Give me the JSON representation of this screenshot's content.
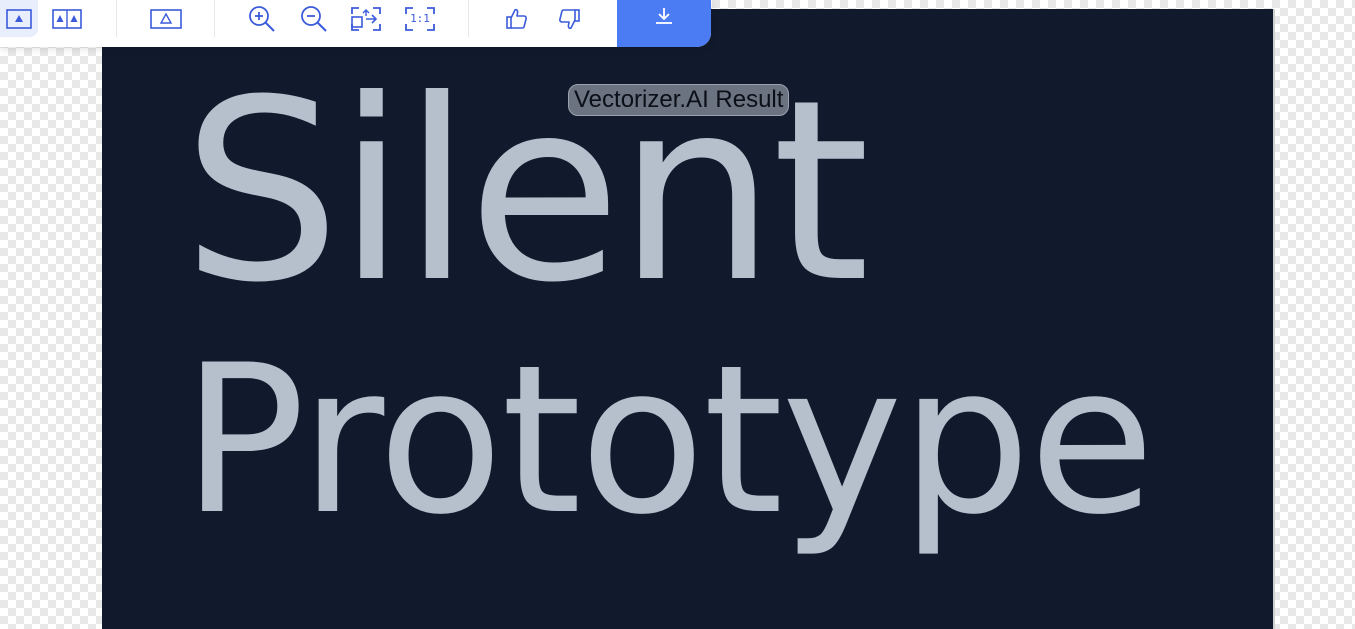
{
  "canvas": {
    "result_label": "Vectorizer.AI Result",
    "art_line_1": "Silent",
    "art_line_2": "Prototype",
    "background_color": "#111a2c",
    "text_color": "#b6bfcc"
  },
  "toolbar": {
    "buttons": [
      {
        "name": "view-single-button",
        "icon": "single-view-icon",
        "active": true
      },
      {
        "name": "view-side-by-side-button",
        "icon": "side-by-side-icon",
        "active": false
      },
      {
        "name": "view-result-button",
        "icon": "triangle-outline-icon",
        "active": false
      },
      {
        "name": "zoom-in-button",
        "icon": "zoom-in-icon",
        "active": false
      },
      {
        "name": "zoom-out-button",
        "icon": "zoom-out-icon",
        "active": false
      },
      {
        "name": "fit-button",
        "icon": "fit-screen-icon",
        "active": false
      },
      {
        "name": "actual-size-button",
        "icon": "one-to-one-icon",
        "label": "1:1",
        "active": false
      },
      {
        "name": "thumbs-up-button",
        "icon": "thumbs-up-icon",
        "active": false
      },
      {
        "name": "thumbs-down-button",
        "icon": "thumbs-down-icon",
        "active": false
      }
    ],
    "download": {
      "icon": "download-icon"
    },
    "accent_color": "#4c7cf3"
  }
}
